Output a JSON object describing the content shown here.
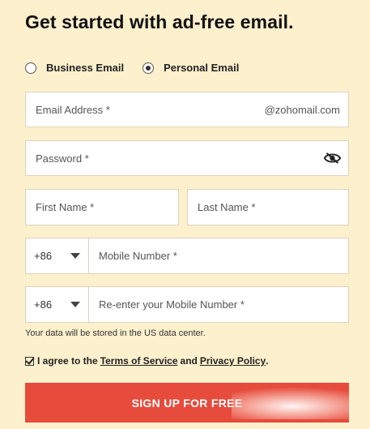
{
  "form": {
    "title": "Get started with ad-free email.",
    "account_types": [
      {
        "label": "Business Email",
        "selected": false
      },
      {
        "label": "Personal Email",
        "selected": true
      }
    ],
    "email": {
      "placeholder": "Email Address *",
      "suffix": "@zohomail.com"
    },
    "password": {
      "placeholder": "Password *",
      "icon": "eye-icon"
    },
    "first_name": {
      "placeholder": "First Name *"
    },
    "last_name": {
      "placeholder": "Last Name *"
    },
    "mobile": {
      "country_code": "+86",
      "placeholder": "Mobile Number *"
    },
    "mobile_confirm": {
      "country_code": "+86",
      "placeholder": "Re-enter your Mobile Number *"
    },
    "data_note": "Your data will be stored in the US data center.",
    "agreement": {
      "checked": true,
      "prefix": "I agree to the",
      "terms_link": "Terms of Service",
      "and_text": "and",
      "privacy_link": "Privacy Policy",
      "suffix": "."
    },
    "submit_label": "SIGN UP FOR FREE"
  },
  "colors": {
    "background": "#fdf0cd",
    "button": "#e64b3c"
  }
}
